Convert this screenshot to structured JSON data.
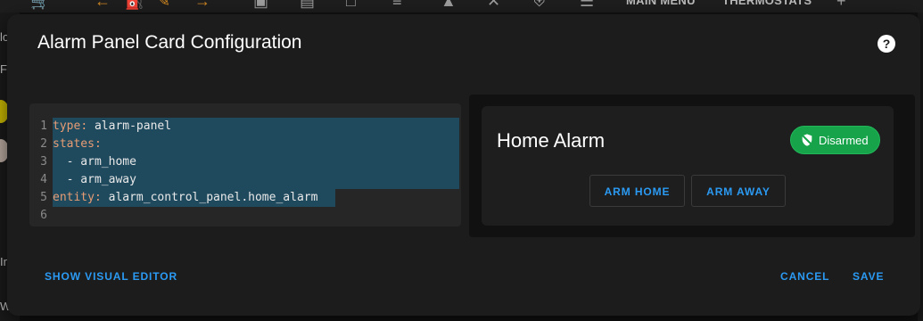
{
  "topbar": {
    "tabs": [
      "MAIN MENU",
      "THERMOSTATS"
    ],
    "icons": [
      "cart-icon",
      "back-arrow-icon",
      "gas-pump-icon",
      "pencil-icon",
      "forward-arrow-icon",
      "rv-icon",
      "bed-icon",
      "bed-outline-icon",
      "radiator-icon",
      "tree-icon",
      "close-icon",
      "shield-home-icon",
      "server-icon",
      "plus-icon"
    ]
  },
  "background": {
    "left_snippets": [
      "lo",
      "Fl",
      "In",
      "Wo"
    ]
  },
  "dialog": {
    "title": "Alarm Panel Card Configuration",
    "help_label": "?",
    "editor": {
      "line_numbers": [
        "1",
        "2",
        "3",
        "4",
        "5",
        "6"
      ],
      "lines": [
        {
          "key": "type",
          "sep": ": ",
          "value": "alarm-panel"
        },
        {
          "key": "states",
          "sep": ":",
          "value": ""
        },
        {
          "key": "",
          "sep": "",
          "value": "  - arm_home"
        },
        {
          "key": "",
          "sep": "",
          "value": "  - arm_away"
        },
        {
          "key": "entity",
          "sep": ": ",
          "value": "alarm_control_panel.home_alarm"
        },
        {
          "key": "",
          "sep": "",
          "value": ""
        }
      ]
    },
    "preview": {
      "card_title": "Home Alarm",
      "badge_label": "Disarmed",
      "badge_color": "#16a34a",
      "buttons": [
        "ARM HOME",
        "ARM AWAY"
      ]
    },
    "actions": {
      "visual_editor": "SHOW VISUAL EDITOR",
      "cancel": "CANCEL",
      "save": "SAVE"
    }
  },
  "colors": {
    "accent": "#2b9af3",
    "yaml_key": "#e79c73",
    "selection": "#1f4a5e"
  }
}
